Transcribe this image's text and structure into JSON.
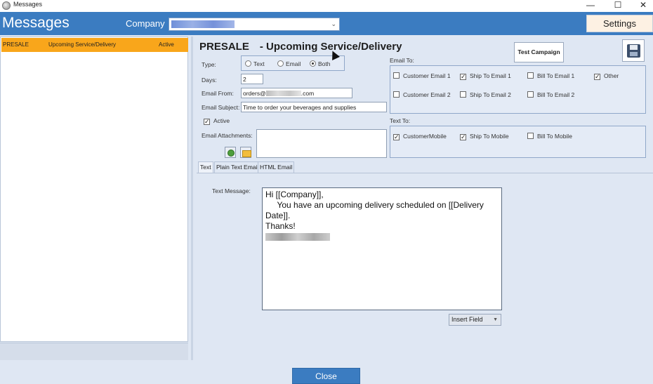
{
  "window": {
    "title": "Messages",
    "controls": {
      "minimize": "—",
      "maximize": "☐",
      "close": "✕"
    }
  },
  "header": {
    "app_title": "Messages",
    "company_label": "Company",
    "settings_label": "Settings"
  },
  "message_list": {
    "rows": [
      {
        "type": "PRESALE",
        "name": "Upcoming Service/Delivery",
        "status": "Active"
      }
    ]
  },
  "campaign": {
    "title_prefix": "PRESALE",
    "title_suffix": "- Upcoming Service/Delivery",
    "test_campaign_label": "Test Campaign",
    "save_icon": "save-disk-icon",
    "type_label": "Type:",
    "type_options": [
      "Text",
      "Email",
      "Both"
    ],
    "type_selected": "Both",
    "days_label": "Days:",
    "days_value": "2",
    "email_from_label": "Email From:",
    "email_from_prefix": "orders@",
    "email_from_suffix": ".com",
    "email_subject_label": "Email Subject:",
    "email_subject_value": "Time to order your beverages and supplies",
    "active_label": "Active",
    "active_checked": true,
    "attachments_label": "Email Attachments:",
    "email_to_label": "Email To:",
    "email_to": [
      {
        "label": "Customer Email 1",
        "checked": false
      },
      {
        "label": "Ship To Email 1",
        "checked": true
      },
      {
        "label": "Bill To Email 1",
        "checked": false
      },
      {
        "label": "Other",
        "checked": true
      },
      {
        "label": "Customer Email 2",
        "checked": false
      },
      {
        "label": "Ship To Email 2",
        "checked": false
      },
      {
        "label": "Bill To Email 2",
        "checked": false
      }
    ],
    "text_to_label": "Text To:",
    "text_to": [
      {
        "label": "CustomerMobile",
        "checked": true
      },
      {
        "label": "Ship To Mobile",
        "checked": true
      },
      {
        "label": "Bill To Mobile",
        "checked": false
      }
    ]
  },
  "tabs": [
    "Text",
    "Plain Text Email",
    "HTML Email"
  ],
  "active_tab": "Text",
  "text_message": {
    "label": "Text Message:",
    "lines": [
      "Hi [[Company]],",
      "     You have an upcoming delivery scheduled on [[Delivery",
      "Date]].",
      "",
      "Thanks!"
    ]
  },
  "insert_field_label": "Insert Field",
  "close_label": "Close",
  "colors": {
    "accent": "#3b7cc1",
    "selected_row": "#f9a61b",
    "panel": "#dfe7f3"
  }
}
